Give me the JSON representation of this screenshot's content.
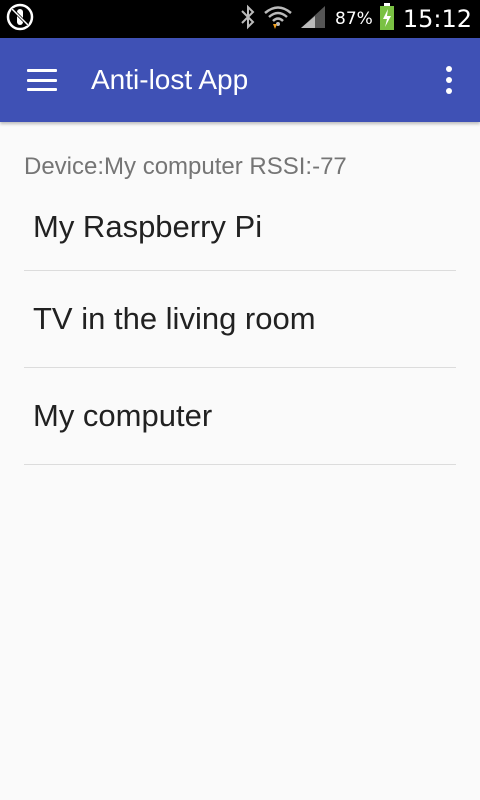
{
  "status_bar": {
    "battery_percent": "87%",
    "time": "15:12",
    "icons": [
      "sync-icon",
      "bluetooth-icon",
      "wifi-icon",
      "signal-icon",
      "battery-charging-icon"
    ]
  },
  "app_bar": {
    "title": "Anti-lost App",
    "background_color": "#3f51b5",
    "menu_icon": "hamburger-icon",
    "overflow_icon": "overflow-menu-icon"
  },
  "main": {
    "device_status": "Device:My computer RSSI:-77",
    "devices": [
      {
        "label": "My Raspberry Pi"
      },
      {
        "label": "TV in the living room"
      },
      {
        "label": "My computer"
      }
    ]
  }
}
